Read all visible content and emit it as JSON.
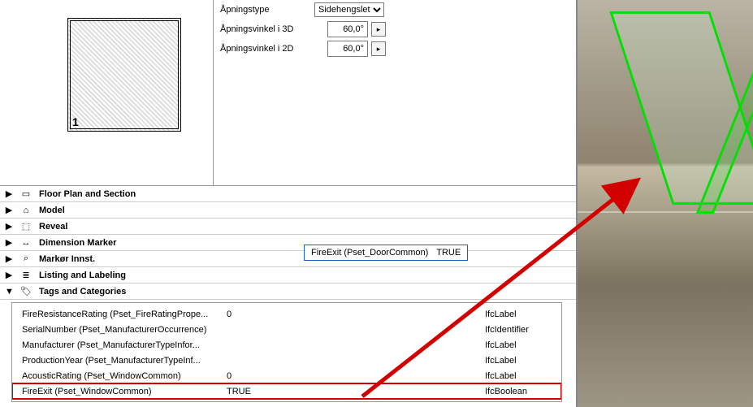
{
  "preview": {
    "index": "1"
  },
  "form": {
    "opening_type_label": "Åpningstype",
    "opening_type_value": "Sidehengslet",
    "angle3d_label": "Åpningsvinkel i 3D",
    "angle3d_value": "60,0°",
    "angle2d_label": "Åpningsvinkel i 2D",
    "angle2d_value": "60,0°"
  },
  "sections": [
    {
      "name": "Floor Plan and Section",
      "expanded": false
    },
    {
      "name": "Model",
      "expanded": false
    },
    {
      "name": "Reveal",
      "expanded": false
    },
    {
      "name": "Dimension Marker",
      "expanded": false
    },
    {
      "name": "Markør Innst.",
      "expanded": false
    },
    {
      "name": "Listing and Labeling",
      "expanded": false
    },
    {
      "name": "Tags and Categories",
      "expanded": true
    }
  ],
  "tooltip": {
    "label": "FireExit (Pset_DoorCommon)",
    "value": "TRUE"
  },
  "properties": [
    {
      "name": "FireResistanceRating (Pset_FireRatingPrope...",
      "value": "0",
      "type": "IfcLabel"
    },
    {
      "name": "SerialNumber (Pset_ManufacturerOccurrence)",
      "value": "",
      "type": "IfcIdentifier"
    },
    {
      "name": "Manufacturer (Pset_ManufacturerTypeInfor...",
      "value": "",
      "type": "IfcLabel"
    },
    {
      "name": "ProductionYear (Pset_ManufacturerTypeInf...",
      "value": "",
      "type": "IfcLabel"
    },
    {
      "name": "AcousticRating (Pset_WindowCommon)",
      "value": "0",
      "type": "IfcLabel"
    },
    {
      "name": "FireExit (Pset_WindowCommon)",
      "value": "TRUE",
      "type": "IfcBoolean",
      "highlight": true
    }
  ]
}
